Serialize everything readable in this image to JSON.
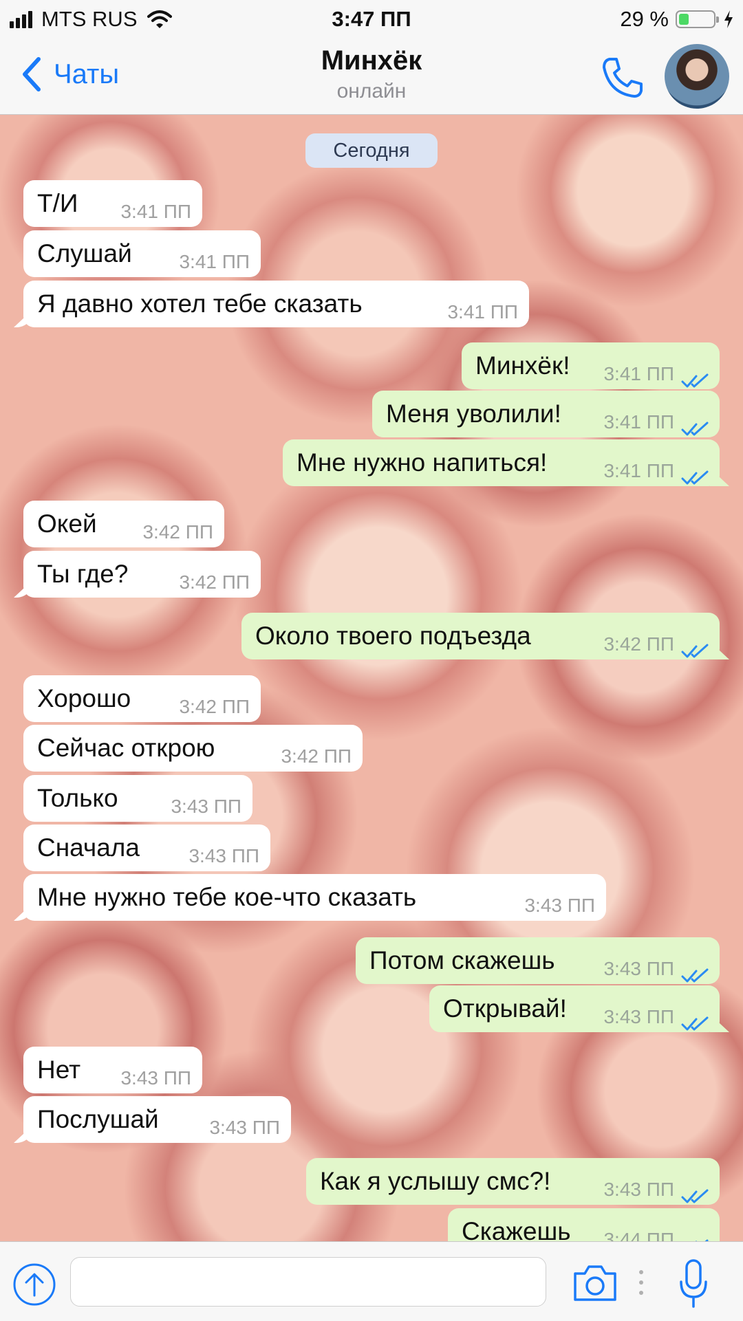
{
  "status_bar": {
    "carrier": "MTS RUS",
    "time": "3:47 ПП",
    "battery_percent": "29 %",
    "battery_level": 0.29
  },
  "nav": {
    "back_label": "Чаты",
    "title": "Минхёк",
    "subtitle": "онлайн"
  },
  "chat": {
    "date_label": "Сегодня",
    "messages": [
      {
        "dir": "in",
        "text": "Т/И",
        "time": "3:41 ПП"
      },
      {
        "dir": "in",
        "text": "Слушай",
        "time": "3:41 ПП"
      },
      {
        "dir": "in",
        "text": "Я давно хотел тебе сказать",
        "time": "3:41 ПП"
      },
      {
        "dir": "out",
        "text": "Минхёк!",
        "time": "3:41 ПП"
      },
      {
        "dir": "out",
        "text": "Меня уволили!",
        "time": "3:41 ПП"
      },
      {
        "dir": "out",
        "text": "Мне нужно напиться!",
        "time": "3:41 ПП"
      },
      {
        "dir": "in",
        "text": "Окей",
        "time": "3:42 ПП"
      },
      {
        "dir": "in",
        "text": "Ты где?",
        "time": "3:42 ПП"
      },
      {
        "dir": "out",
        "text": "Около твоего подъезда",
        "time": "3:42 ПП"
      },
      {
        "dir": "in",
        "text": "Хорошо",
        "time": "3:42 ПП"
      },
      {
        "dir": "in",
        "text": "Сейчас открою",
        "time": "3:42 ПП"
      },
      {
        "dir": "in",
        "text": "Только",
        "time": "3:43 ПП"
      },
      {
        "dir": "in",
        "text": "Сначала",
        "time": "3:43 ПП"
      },
      {
        "dir": "in",
        "text": "Мне нужно тебе кое-что сказать",
        "time": "3:43 ПП"
      },
      {
        "dir": "out",
        "text": "Потом скажешь",
        "time": "3:43 ПП"
      },
      {
        "dir": "out",
        "text": "Открывай!",
        "time": "3:43 ПП"
      },
      {
        "dir": "in",
        "text": "Нет",
        "time": "3:43 ПП"
      },
      {
        "dir": "in",
        "text": "Послушай",
        "time": "3:43 ПП"
      },
      {
        "dir": "out",
        "text": "Как я услышу смс?!",
        "time": "3:43 ПП"
      },
      {
        "dir": "out",
        "text": "Скажешь",
        "time": "3:44 ПП"
      }
    ]
  },
  "input": {
    "placeholder": "",
    "value": ""
  },
  "icons": {
    "back": "chevron-left-icon",
    "call": "phone-icon",
    "attach": "upload-arrow-icon",
    "camera": "camera-icon",
    "mic": "microphone-icon",
    "read_receipt": "double-check-icon"
  },
  "colors": {
    "accent": "#1a7af8",
    "incoming_bubble": "#ffffff",
    "outgoing_bubble": "#e2f7cb",
    "read_ticks": "#2a8bf2"
  }
}
